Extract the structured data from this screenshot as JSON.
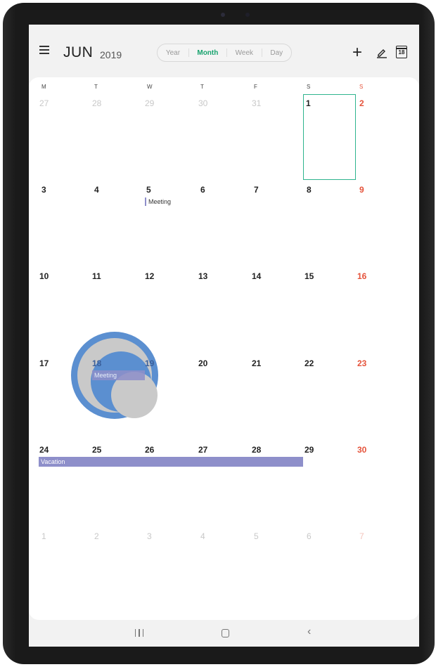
{
  "header": {
    "month": "JUN",
    "year": "2019",
    "views": [
      "Year",
      "Month",
      "Week",
      "Day"
    ],
    "active_view": "Month",
    "today_icon_number": "18"
  },
  "weekdays": [
    "M",
    "T",
    "W",
    "T",
    "F",
    "S",
    "S"
  ],
  "weeks": [
    [
      "27",
      "28",
      "29",
      "30",
      "31",
      "1",
      "2"
    ],
    [
      "3",
      "4",
      "5",
      "6",
      "7",
      "8",
      "9"
    ],
    [
      "10",
      "11",
      "12",
      "13",
      "14",
      "15",
      "16"
    ],
    [
      "17",
      "18",
      "19",
      "20",
      "21",
      "22",
      "23"
    ],
    [
      "24",
      "25",
      "26",
      "27",
      "28",
      "29",
      "30"
    ],
    [
      "1",
      "2",
      "3",
      "4",
      "5",
      "6",
      "7"
    ]
  ],
  "events": {
    "meeting_5": "Meeting",
    "meeting_18": "Meeting",
    "vacation": "Vacation"
  },
  "colors": {
    "accent": "#18a36e",
    "sunday": "#e5533b",
    "event": "#8e8fca",
    "touch_indicator": "#5b8fd0"
  },
  "icons": [
    "menu-icon",
    "add-icon",
    "edit-icon",
    "today-calendar-icon",
    "recents-icon",
    "home-icon",
    "back-icon"
  ]
}
